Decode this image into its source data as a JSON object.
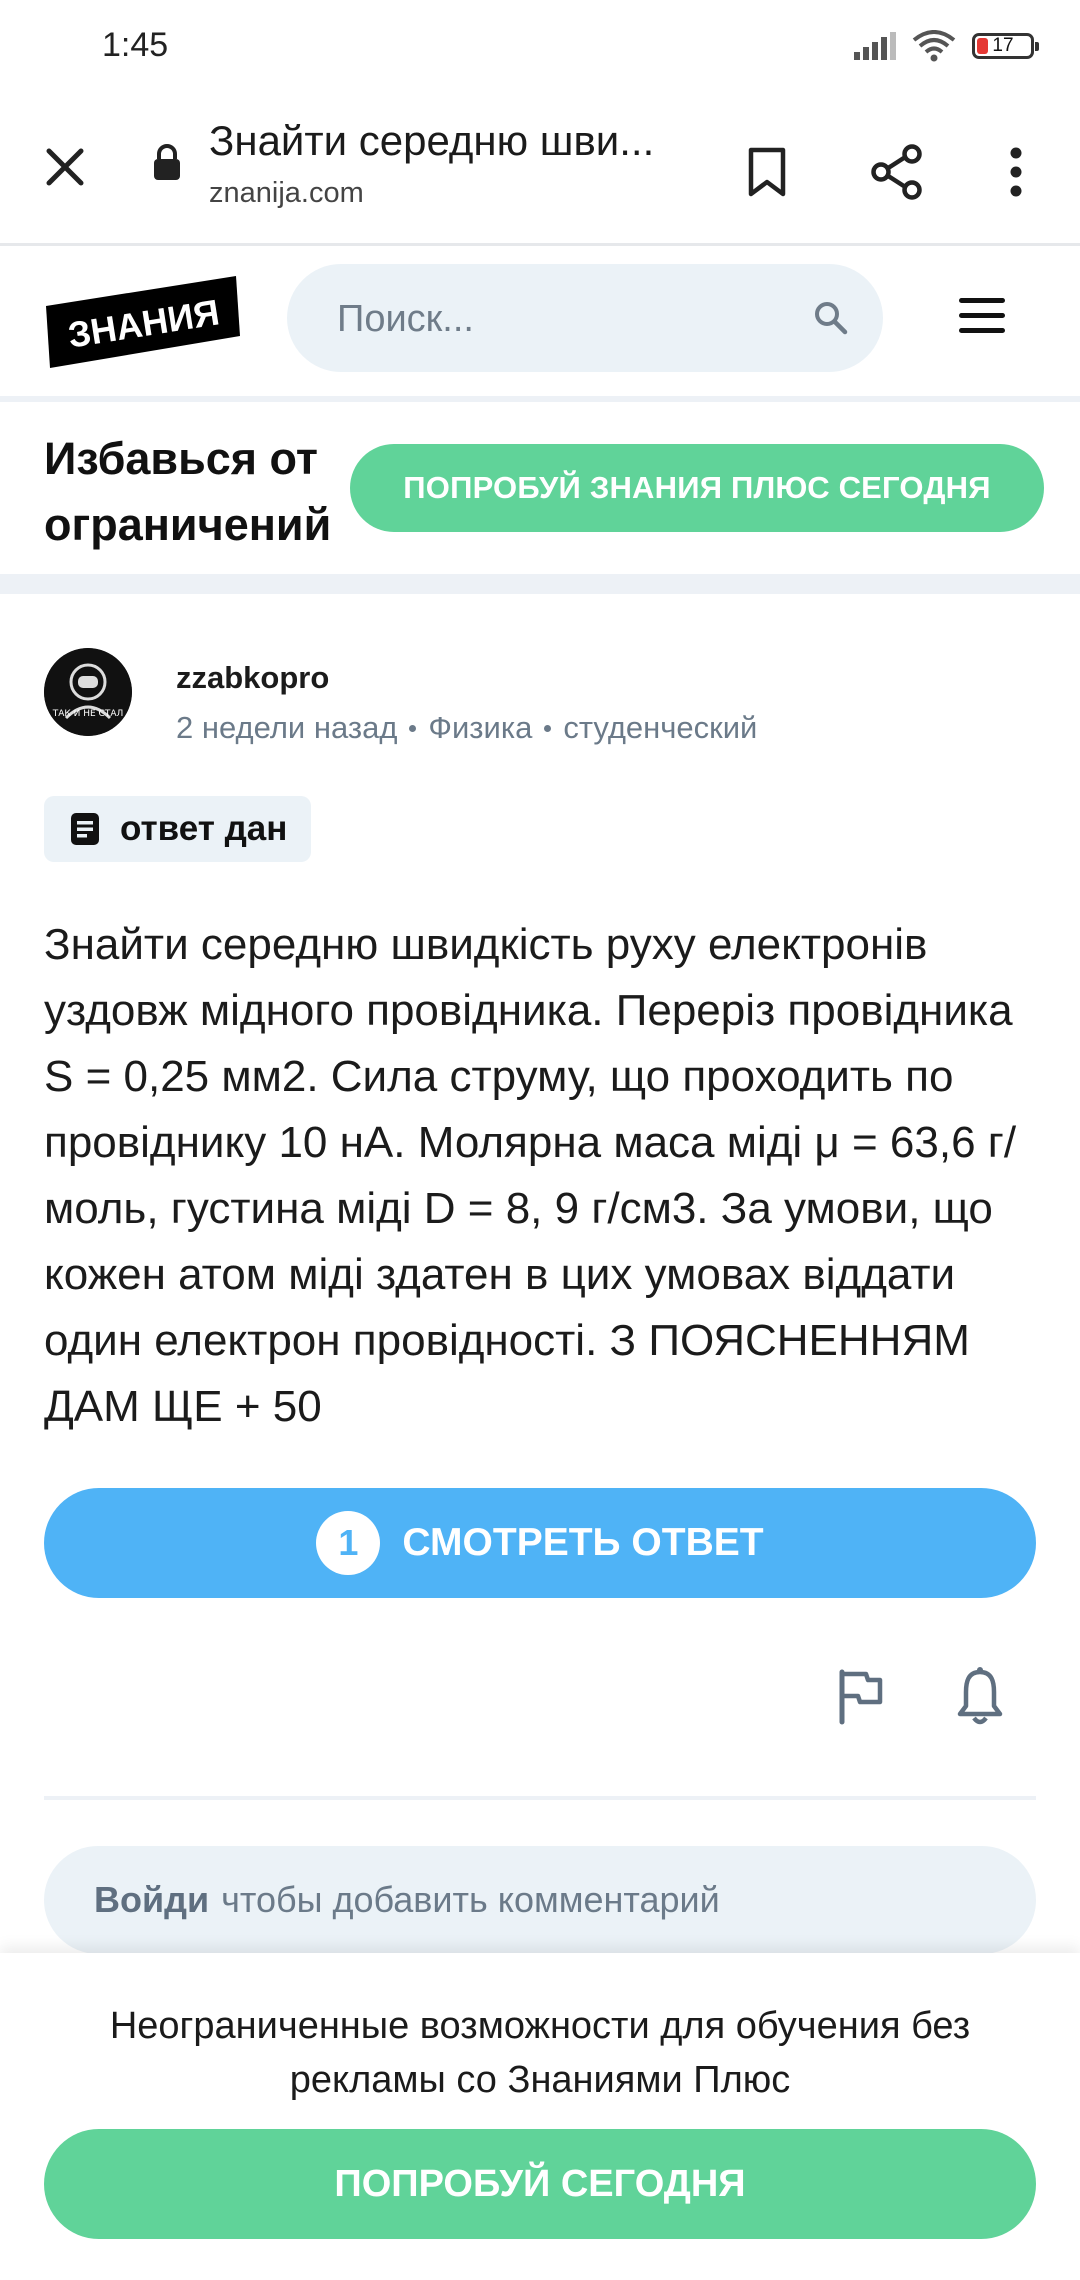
{
  "status_bar": {
    "time": "1:45",
    "battery": "17"
  },
  "browser": {
    "title": "Знайти середню шви...",
    "url": "znanija.com"
  },
  "site": {
    "logo_text": "ЗНАНИЯ",
    "search_placeholder": "Поиск..."
  },
  "promo": {
    "title_line1": "Избавься от",
    "title_line2": "ограничений",
    "button": "ПОПРОБУЙ ЗНАНИЯ ПЛЮС СЕГОДНЯ"
  },
  "question": {
    "author": "zzabkopro",
    "avatar_text": "ТАК И НЕ СТАЛ",
    "time_ago": "2 недели назад",
    "subject": "Физика",
    "level": "студенческий",
    "badge": "ответ дан",
    "text": "Знайти середню швидкість руху електронів уздовж мідного провідника. Переріз провідника S = 0,25 мм2. Сила струму, що проходить по провіднику 10 нА. Молярна маса міді μ = 63,6 г/моль, густина міді D = 8, 9 г/см3. За умови, що кожен атом міді здатен в цих умовах віддати один електрон провідності. З ПОЯСНЕННЯМ ДАМ ЩЕ + 50",
    "answers_count": "1",
    "view_answer": "СМОТРЕТЬ ОТВЕТ"
  },
  "comment": {
    "login": "Войди",
    "prompt": "чтобы добавить комментарий"
  },
  "bottom": {
    "text": "Неограниченные возможности для обучения без рекламы со Знаниями Плюс",
    "button": "ПОПРОБУЙ СЕГОДНЯ"
  },
  "colors": {
    "green": "#60d399",
    "blue": "#4fb3f6",
    "light": "#ebf2f7"
  }
}
